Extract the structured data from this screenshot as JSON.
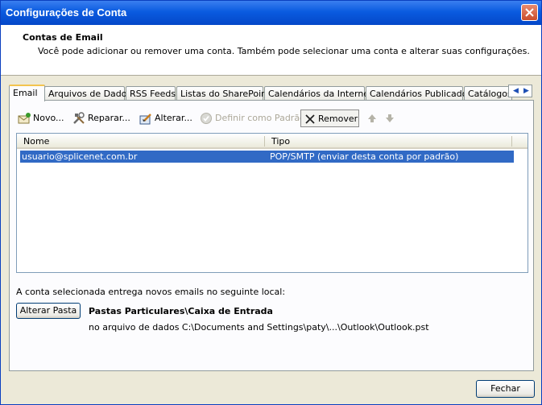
{
  "window": {
    "title": "Configurações de Conta"
  },
  "header": {
    "title": "Contas de Email",
    "description": "Você pode adicionar ou remover uma conta. Também pode selecionar uma conta e alterar suas configurações."
  },
  "tabs": [
    {
      "label": "Email",
      "active": true
    },
    {
      "label": "Arquivos de Dados"
    },
    {
      "label": "RSS Feeds"
    },
    {
      "label": "Listas do SharePoint"
    },
    {
      "label": "Calendários da Internet"
    },
    {
      "label": "Calendários Publicados"
    },
    {
      "label": "Catálogos"
    }
  ],
  "toolbar": {
    "new_label": "Novo...",
    "repair_label": "Reparar...",
    "change_label": "Alterar...",
    "set_default_label": "Definir como Padrão",
    "remove_label": "Remover"
  },
  "accounts_table": {
    "columns": [
      "Nome",
      "Tipo"
    ],
    "rows": [
      {
        "name": "usuario@splicenet.com.br",
        "type": "POP/SMTP (enviar desta conta por padrão)",
        "selected": true
      }
    ]
  },
  "delivery": {
    "label": "A conta selecionada entrega novos emails no seguinte local:",
    "change_folder_label": "Alterar Pasta",
    "folder": "Pastas Particulares\\Caixa de Entrada",
    "data_file": "no arquivo de dados C:\\Documents and Settings\\paty\\...\\Outlook\\Outlook.pst"
  },
  "footer": {
    "close_label": "Fechar"
  },
  "colors": {
    "titlebar": "#0a5be0",
    "selection": "#316ac5",
    "dialog_bg": "#ece9d8"
  }
}
